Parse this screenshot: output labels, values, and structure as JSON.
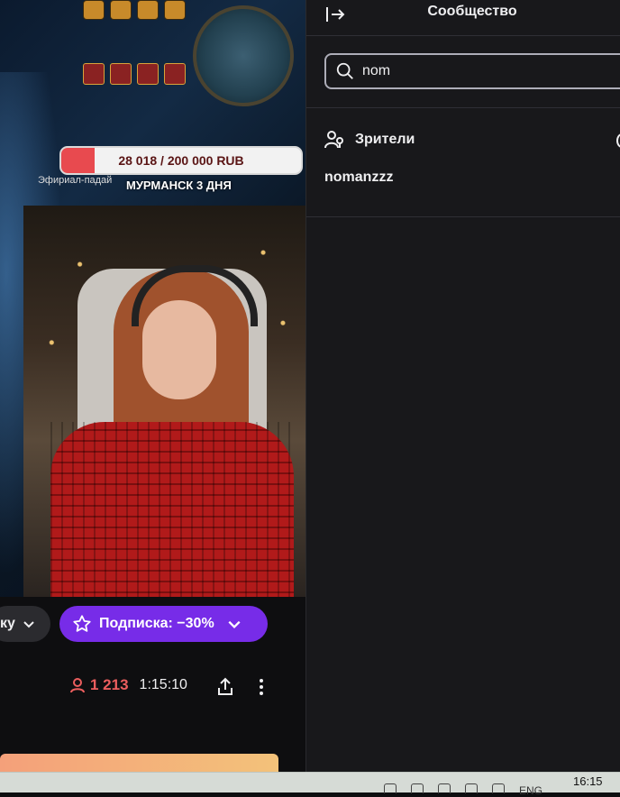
{
  "stream": {
    "donation_goal_text": "28 018 / 200 000 RUB",
    "donation_progress": 0.14,
    "overlay_city_text": "МУРМАНСК 3 ДНЯ",
    "overlay_quest_text": "Эфириал-падай"
  },
  "actions": {
    "prev_chip_label": "ку",
    "subscribe_label": "Подписка: −30%"
  },
  "stats": {
    "viewer_count": "1 213",
    "uptime": "1:15:10"
  },
  "panel": {
    "title": "Сообщество",
    "search_value": "nom",
    "section_label": "Зрители",
    "viewers": [
      "nomanzzz"
    ]
  },
  "taskbar": {
    "time": "16:15",
    "lang": "ENG"
  },
  "colors": {
    "accent_purple": "#772ce8",
    "live_red": "#eb5e5e",
    "panel_bg": "#18181b"
  }
}
